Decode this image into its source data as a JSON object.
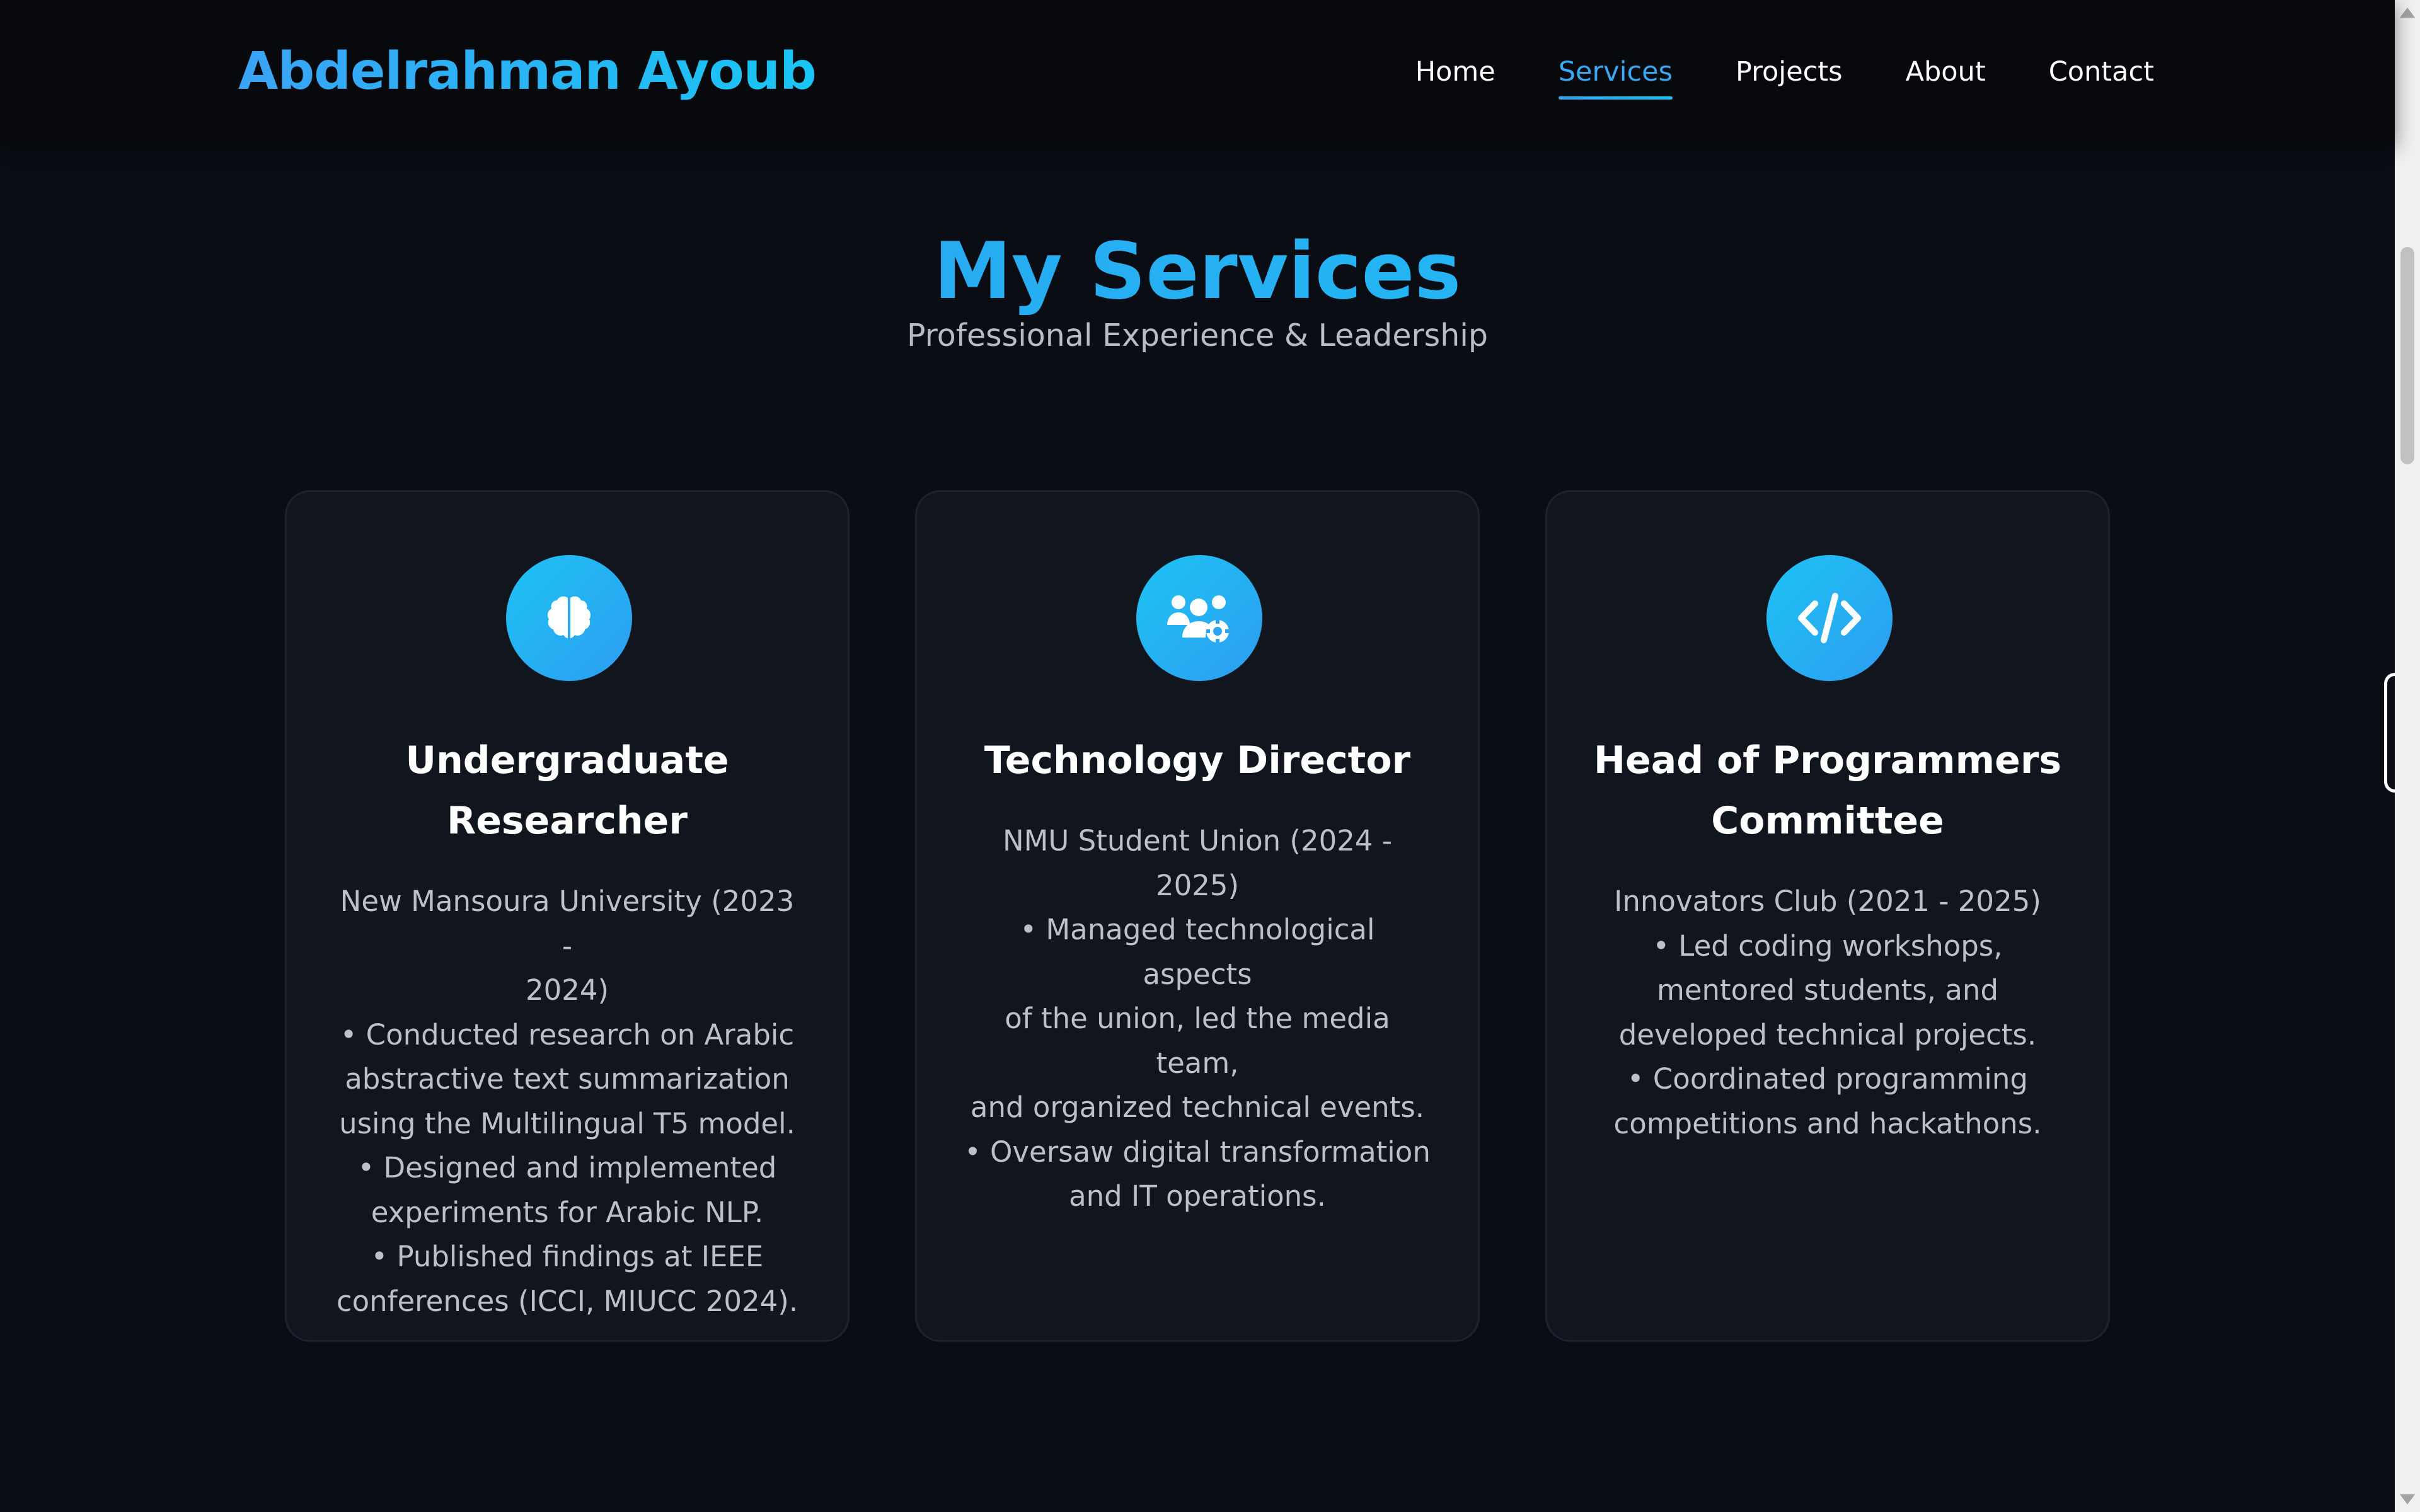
{
  "header": {
    "logo": "Abdelrahman Ayoub",
    "nav": [
      {
        "label": "Home",
        "active": false
      },
      {
        "label": "Services",
        "active": true
      },
      {
        "label": "Projects",
        "active": false
      },
      {
        "label": "About",
        "active": false
      },
      {
        "label": "Contact",
        "active": false
      }
    ]
  },
  "section": {
    "title": "My Services",
    "subtitle": "Professional Experience & Leadership"
  },
  "cards": [
    {
      "icon": "brain-icon",
      "title": "Undergraduate Researcher",
      "lines": [
        "New Mansoura University (2023 -",
        "2024)",
        "• Conducted research on Arabic",
        "abstractive text summarization",
        "using the Multilingual T5 model.",
        "• Designed and implemented",
        "experiments for Arabic NLP.",
        "• Published findings at IEEE",
        "conferences (ICCI, MIUCC 2024)."
      ]
    },
    {
      "icon": "users-gear-icon",
      "title": "Technology Director",
      "lines": [
        "NMU Student Union (2024 - 2025)",
        "• Managed technological aspects",
        "of the union, led the media team,",
        "and organized technical events.",
        "• Oversaw digital transformation",
        "and IT operations."
      ]
    },
    {
      "icon": "code-icon",
      "title": "Head of Programmers Committee",
      "lines": [
        "Innovators Club (2021 - 2025)",
        "• Led coding workshops,",
        "mentored students, and",
        "developed technical projects.",
        "• Coordinated programming",
        "competitions and hackathons."
      ]
    }
  ],
  "colors": {
    "background": "#0a0d14",
    "card": "#11151e",
    "accent": "#2d9cf0",
    "accent_light": "#1ec4f5",
    "text_muted": "#bcc0c9"
  }
}
